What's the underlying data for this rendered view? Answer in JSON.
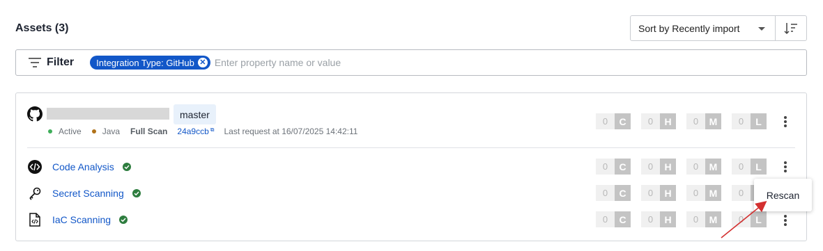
{
  "header": {
    "title": "Assets (3)",
    "sort_label": "Sort by Recently import",
    "sort_caret_icon": "chevron-down-icon",
    "sort_direction_icon": "sort-descending-icon"
  },
  "filter": {
    "label": "Filter",
    "icon": "filter-lines-icon",
    "chip_label": "Integration Type: GitHub",
    "chip_remove_icon": "close-circle-icon",
    "placeholder": "Enter property name or value",
    "value": ""
  },
  "asset": {
    "repo_icon": "github-icon",
    "repo_name_redacted": true,
    "branch": "master",
    "status": "Active",
    "status_color": "#3fae5a",
    "language": "Java",
    "language_color": "#b07219",
    "scan_type": "Full Scan",
    "commit": "24a9ccb",
    "commit_icon": "external-link-icon",
    "last_request": "Last request at 16/07/2025 14:42:11",
    "severity": [
      {
        "count": "0",
        "letter": "C"
      },
      {
        "count": "0",
        "letter": "H"
      },
      {
        "count": "0",
        "letter": "M"
      },
      {
        "count": "0",
        "letter": "L"
      }
    ]
  },
  "scans": [
    {
      "name": "Code Analysis",
      "icon": "code-brackets-icon",
      "status_icon": "check-circle-icon",
      "severity": [
        {
          "count": "0",
          "letter": "C"
        },
        {
          "count": "0",
          "letter": "H"
        },
        {
          "count": "0",
          "letter": "M"
        },
        {
          "count": "0",
          "letter": "L"
        }
      ]
    },
    {
      "name": "Secret Scanning",
      "icon": "key-icon",
      "status_icon": "check-circle-icon",
      "severity": [
        {
          "count": "0",
          "letter": "C"
        },
        {
          "count": "0",
          "letter": "H"
        },
        {
          "count": "0",
          "letter": "M"
        },
        {
          "count": "0",
          "letter": "L"
        }
      ]
    },
    {
      "name": "IaC Scanning",
      "icon": "code-file-icon",
      "status_icon": "check-circle-icon",
      "severity": [
        {
          "count": "0",
          "letter": "C"
        },
        {
          "count": "0",
          "letter": "H"
        },
        {
          "count": "0",
          "letter": "M"
        },
        {
          "count": "0",
          "letter": "L"
        }
      ]
    }
  ],
  "menu": {
    "rescan_label": "Rescan"
  },
  "colors": {
    "accent": "#1257c8",
    "success": "#2e7d3f",
    "annotation_arrow": "#d32f2f"
  }
}
